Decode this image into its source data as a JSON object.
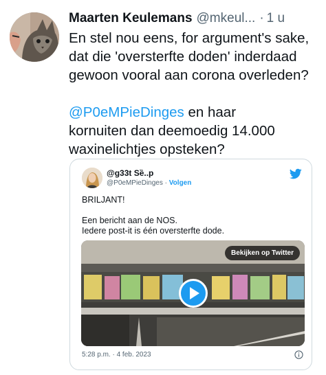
{
  "tweet": {
    "author_name": "Maarten Keulemans",
    "author_handle": "@mkeul...",
    "separator": "·",
    "time_ago": "1 u",
    "lines": [
      "En stel nou eens, for argument's sake,",
      "dat die 'oversterfte doden' inderdaad",
      "gewoon vooral aan corona overleden?"
    ],
    "line4_mention": "@P0eMPieDinges",
    "line4_rest": " en haar",
    "line5": "kornuiten dan deemoedig 14.000",
    "line6": "waxinelichtjes opsteken?"
  },
  "embedded": {
    "author_name": "@g33t Sȅ..p",
    "author_handle": "@P0eMPieDinges",
    "separator": " · ",
    "follow_label": "Volgen",
    "body_line1": "BRILJANT!",
    "body_line2": "Een bericht aan de NOS.",
    "body_line3": "Iedere post-it is één oversterfte dode.",
    "watch_label": "Bekijken op Twitter",
    "timestamp": "5:28 p.m. · 4 feb. 2023"
  },
  "colors": {
    "accent": "#1d9bf0",
    "text": "#0f1419",
    "muted": "#536471",
    "border": "#cfd9de"
  },
  "icons": {
    "bird": "twitter-bird-icon",
    "play": "play-icon",
    "info": "info-icon"
  }
}
